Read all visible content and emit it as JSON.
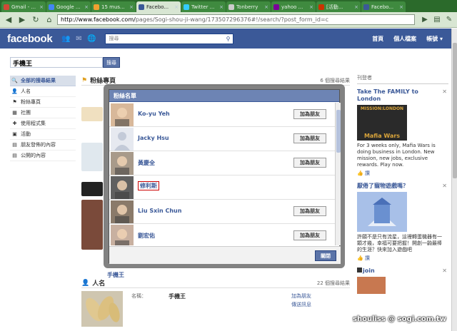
{
  "browser": {
    "tabs": [
      {
        "label": "Gmail - ...",
        "fav": "#d14836"
      },
      {
        "label": "Google ...",
        "fav": "#4285f4"
      },
      {
        "label": "15 mus...",
        "fav": "#f0a030"
      },
      {
        "label": "Facebo...",
        "fav": "#3b5998",
        "active": true
      },
      {
        "label": "Twitter ...",
        "fav": "#33ccff"
      },
      {
        "label": "Tonberry",
        "fav": "#ccc"
      },
      {
        "label": "yahoo ...",
        "fav": "#7b0099"
      },
      {
        "label": "[活動...",
        "fav": "#cc3300"
      },
      {
        "label": "Facebo...",
        "fav": "#3b5998"
      }
    ],
    "url_host": "http://www.facebook.com/",
    "url_rest": "pages/Sogi-shou-ji-wang/173507296376#!/search/?post_form_id=c"
  },
  "fb": {
    "logo": "facebook",
    "search_placeholder": "搜尋",
    "nav": [
      "首頁",
      "個人檔案",
      "帳號 ▾"
    ]
  },
  "search": {
    "query": "手機王",
    "button": "搜尋"
  },
  "leftnav": [
    {
      "label": "全部的搜尋結果",
      "icon": "🔍",
      "selected": true
    },
    {
      "label": "人名",
      "icon": "👤"
    },
    {
      "label": "粉絲專頁",
      "icon": "⚑"
    },
    {
      "label": "社團",
      "icon": "▦"
    },
    {
      "label": "使用程式集",
      "icon": "✚"
    },
    {
      "label": "活動",
      "icon": "▣"
    },
    {
      "label": "朋友發佈的內容",
      "icon": "▤"
    },
    {
      "label": "公開的內容",
      "icon": "▤"
    }
  ],
  "main": {
    "fanpages_title": "粉絲專頁",
    "fanpages_count": "6 個搜尋結果",
    "people_title": "人名",
    "people_count": "22 個搜尋結果",
    "result_label": "名稱：",
    "result_value": "手機王",
    "result_add": "加為朋友",
    "result_msg": "傳送訊息"
  },
  "dialog": {
    "title": "粉絲名單",
    "add_label": "加為朋友",
    "close_label": "關閉",
    "fans": [
      {
        "name": "Ko-yu Yeh",
        "add": true
      },
      {
        "name": "Jacky Hsu",
        "add": true
      },
      {
        "name": "黃慶全",
        "add": true
      },
      {
        "name": "修利斯",
        "add": false,
        "boxed": true
      },
      {
        "name": "Liu Sxin Chun",
        "add": true
      },
      {
        "name": "劉宏佑",
        "add": true
      }
    ]
  },
  "ads": {
    "header": "刊登者",
    "ad1_title": "Take The FAMILY to London",
    "ad1_img_top": "MISSION:LONDON",
    "ad1_img_bottom": "Mafia Wars",
    "ad1_body": "For 3 weeks only, Mafia Wars is doing business in London. New mission, new jobs, exclusive rewards. Play now.",
    "ad1_like": "讚",
    "ad2_title": "厭倦了寵物遊戲嗎？",
    "ad2_body": "許願不是只有流星，這裡轉蛋機器有一顆才幾，幸福可要把握！開創一齣最棒的生涯？快來加入遊戲吧",
    "ad2_like": "讚",
    "ad3_title": "join"
  },
  "watermark": "shouliss @ sogi.com.tw"
}
